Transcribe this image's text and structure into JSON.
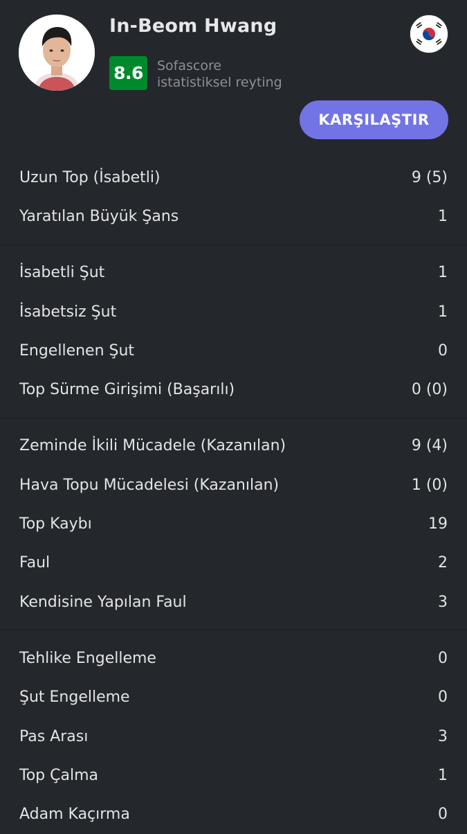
{
  "player": {
    "name": "In-Beom Hwang",
    "rating": "8.6",
    "rating_label_line1": "Sofascore",
    "rating_label_line2": "istatistiksel reyting",
    "country_flag_icon": "south-korea-flag-icon",
    "rating_color": "#00892c"
  },
  "actions": {
    "compare_label": "KARŞILAŞTIR",
    "accent_color": "#7274e6"
  },
  "stat_groups": [
    [
      {
        "label": "Uzun Top (İsabetli)",
        "value": "9 (5)"
      },
      {
        "label": "Yaratılan Büyük Şans",
        "value": "1"
      }
    ],
    [
      {
        "label": "İsabetli Şut",
        "value": "1"
      },
      {
        "label": "İsabetsiz Şut",
        "value": "1"
      },
      {
        "label": "Engellenen Şut",
        "value": "0"
      },
      {
        "label": "Top Sürme Girişimi (Başarılı)",
        "value": "0 (0)"
      }
    ],
    [
      {
        "label": "Zeminde İkili Mücadele (Kazanılan)",
        "value": "9 (4)"
      },
      {
        "label": "Hava Topu Mücadelesi (Kazanılan)",
        "value": "1 (0)"
      },
      {
        "label": "Top Kaybı",
        "value": "19"
      },
      {
        "label": "Faul",
        "value": "2"
      },
      {
        "label": "Kendisine Yapılan Faul",
        "value": "3"
      }
    ],
    [
      {
        "label": "Tehlike Engelleme",
        "value": "0"
      },
      {
        "label": "Şut Engelleme",
        "value": "0"
      },
      {
        "label": "Pas Arası",
        "value": "3"
      },
      {
        "label": "Top Çalma",
        "value": "1"
      },
      {
        "label": "Adam Kaçırma",
        "value": "0"
      }
    ]
  ]
}
